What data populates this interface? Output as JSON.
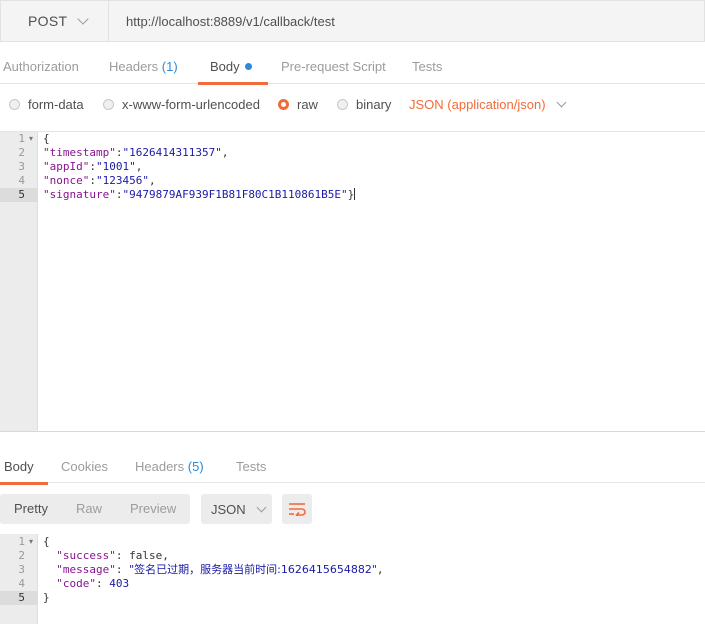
{
  "request": {
    "method": "POST",
    "url": "http://localhost:8889/v1/callback/test"
  },
  "request_tabs": [
    {
      "label": "Authorization"
    },
    {
      "label": "Headers",
      "count": "(1)"
    },
    {
      "label": "Body",
      "active": true
    },
    {
      "label": "Pre-request Script"
    },
    {
      "label": "Tests"
    }
  ],
  "body_types": [
    {
      "label": "form-data",
      "selected": false
    },
    {
      "label": "x-www-form-urlencoded",
      "selected": false
    },
    {
      "label": "raw",
      "selected": true
    },
    {
      "label": "binary",
      "selected": false
    }
  ],
  "content_type": "JSON (application/json)",
  "request_body": {
    "line_numbers": [
      "1",
      "2",
      "3",
      "4",
      "5"
    ],
    "open_brace": "{",
    "fields": [
      {
        "key": "\"timestamp\"",
        "value": "\"1626414311357\"",
        "trail": ","
      },
      {
        "key": "\"appId\"",
        "value": "\"1001\"",
        "trail": ","
      },
      {
        "key": "\"nonce\"",
        "value": "\"123456\"",
        "trail": ","
      },
      {
        "key": "\"signature\"",
        "value": "\"9479879AF939F1B81F80C1B110861B5E\"",
        "trail": "}"
      }
    ]
  },
  "response_tabs": [
    {
      "label": "Body",
      "active": true
    },
    {
      "label": "Cookies"
    },
    {
      "label": "Headers",
      "count": "(5)"
    },
    {
      "label": "Tests"
    }
  ],
  "response_views": [
    "Pretty",
    "Raw",
    "Preview"
  ],
  "response_format": "JSON",
  "icons": {
    "wrap": "wrap-lines-icon",
    "dropdown": "chevron-down-icon",
    "fold": "fold-arrow-icon"
  },
  "colors": {
    "accent": "#f26b3a",
    "link_blue": "#2d8ad8",
    "json_key": "#881391",
    "json_string": "#1a1aa6"
  },
  "response_body": {
    "line_numbers": [
      "1",
      "2",
      "3",
      "4",
      "5"
    ],
    "open_brace": "{",
    "close_brace": "}",
    "success_key": "\"success\"",
    "success_val": "false",
    "message_key": "\"message\"",
    "message_val": "\"签名已过期，服务器当前时间:1626415654882\"",
    "code_key": "\"code\"",
    "code_val": "403"
  }
}
